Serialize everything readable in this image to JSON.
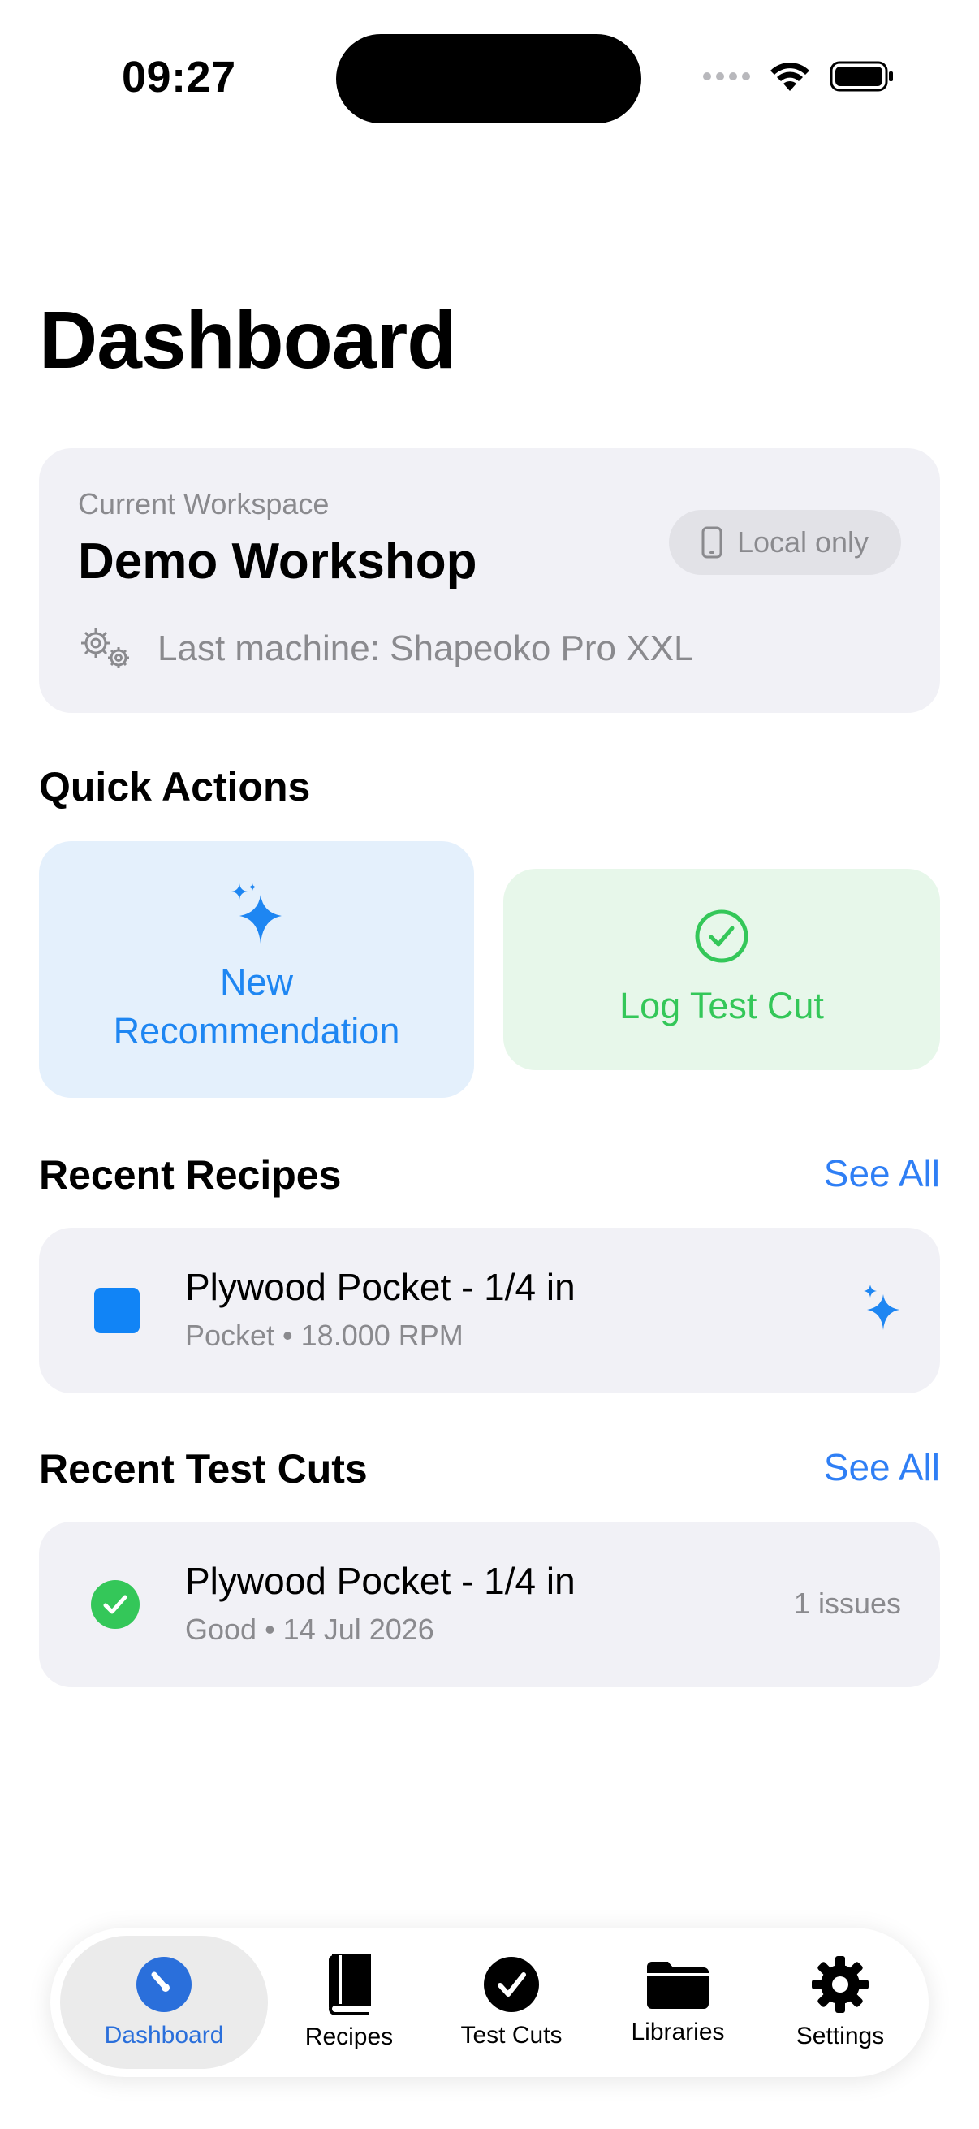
{
  "status_bar": {
    "time": "09:27"
  },
  "page": {
    "title": "Dashboard"
  },
  "workspace": {
    "label": "Current Workspace",
    "name": "Demo Workshop",
    "badge": "Local only",
    "machine": "Last machine: Shapeoko Pro XXL"
  },
  "quick_actions": {
    "title": "Quick Actions",
    "new_recommendation": {
      "line1": "New",
      "line2": "Recommendation"
    },
    "log_test_cut": "Log Test Cut"
  },
  "recent_recipes": {
    "title": "Recent Recipes",
    "see_all": "See All",
    "items": [
      {
        "title": "Plywood Pocket - 1/4 in",
        "subtitle": "Pocket • 18.000 RPM"
      }
    ]
  },
  "recent_test_cuts": {
    "title": "Recent Test Cuts",
    "see_all": "See All",
    "items": [
      {
        "title": "Plywood Pocket - 1/4 in",
        "subtitle": "Good • 14 Jul 2026",
        "issues": "1 issues"
      }
    ]
  },
  "tab_bar": {
    "active": "Dashboard",
    "tabs": [
      {
        "label": "Dashboard",
        "icon": "gauge-icon"
      },
      {
        "label": "Recipes",
        "icon": "book-icon"
      },
      {
        "label": "Test Cuts",
        "icon": "checkmark-circle-icon"
      },
      {
        "label": "Libraries",
        "icon": "folder-icon"
      },
      {
        "label": "Settings",
        "icon": "gear-icon"
      }
    ]
  },
  "colors": {
    "accent_blue": "#2f7ff5",
    "success_green": "#34c759",
    "card_background": "#f1f1f6",
    "recipe_square": "#1184f6"
  }
}
